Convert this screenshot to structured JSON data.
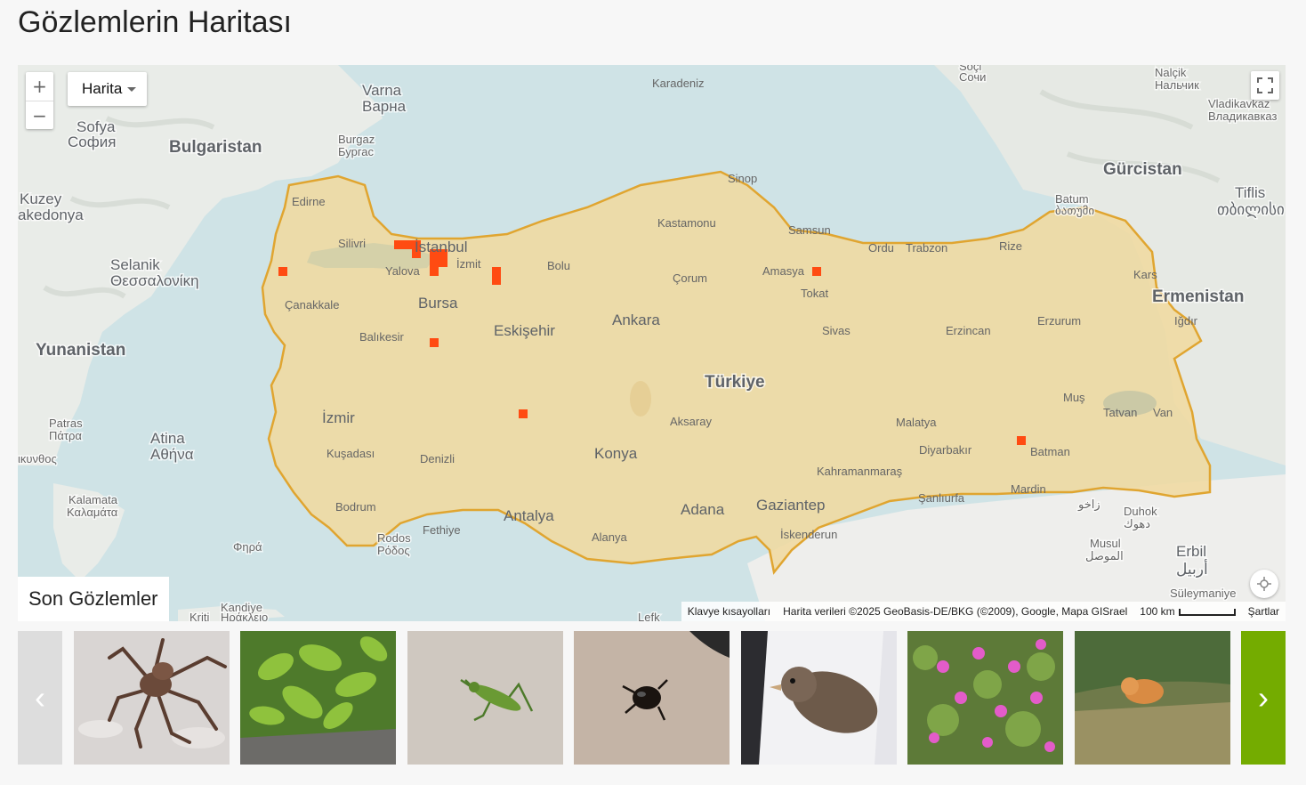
{
  "page": {
    "title": "Gözlemlerin Haritası"
  },
  "map": {
    "controls": {
      "zoom_in": "+",
      "zoom_out": "−",
      "map_type": "Harita"
    },
    "overlay_label": "Son Gözlemler",
    "attribution": {
      "shortcuts": "Klavye kısayolları",
      "data": "Harita verileri ©2025 GeoBasis-DE/BKG (©2009), Google, Mapa GISrael",
      "scale": "100 km",
      "terms": "Şartlar"
    },
    "labels": {
      "sea": "Karadeniz",
      "bulgaria": "Bulgaristan",
      "georgia": "Gürcistan",
      "armenia": "Ermenistan",
      "greece": "Yunanistan",
      "turkey": "Türkiye",
      "north_macedonia_1": "Kuzey",
      "north_macedonia_2": "akedonya",
      "varna_1": "Varna",
      "varna_2": "Варна",
      "sofia_1": "Sofya",
      "sofia_2": "София",
      "burgaz_1": "Burgaz",
      "burgaz_2": "Бургас",
      "selanik_1": "Selanik",
      "selanik_2": "Θεσσαλονίκη",
      "athens_1": "Atina",
      "athens_2": "Αθήνα",
      "patras_1": "Patras",
      "patras_2": "Πάτρα",
      "kalamata_1": "Kalamata",
      "kalamata_2": "Καλαμάτα",
      "rodos_1": "Rodos",
      "rodos_2": "Ρόδος",
      "kandiye_1": "Kandiye",
      "kandiye_2": "Ηράκλειο",
      "fira": "Φηρά",
      "sochi_1": "Soçi",
      "sochi_2": "Сочи",
      "nalcik_1": "Nalçik",
      "nalcik_2": "Нальчик",
      "vladikavkaz_1": "Vladikavkaz",
      "vladikavkaz_2": "Владикавказ",
      "tiflis_1": "Tiflis",
      "tiflis_2": "თბილისი",
      "batum_1": "Batum",
      "batum_2": "ბათუმი",
      "erbil_1": "Erbil",
      "erbil_2": "أربيل",
      "musul_1": "Musul",
      "musul_2": "الموصل",
      "duhok_1": "Duhok",
      "duhok_2": "دهوك",
      "zakho": "زاخو",
      "suleymaniye": "Süleymaniye",
      "edirne": "Edirne",
      "silivri": "Silivri",
      "istanbul": "İstanbul",
      "yalova": "Yalova",
      "izmit": "İzmit",
      "bursa": "Bursa",
      "bolu": "Bolu",
      "canakkale": "Çanakkale",
      "balikesir": "Balıkesir",
      "eskisehir": "Eskişehir",
      "ankara": "Ankara",
      "kastamonu": "Kastamonu",
      "sinop": "Sinop",
      "samsun": "Samsun",
      "ordu": "Ordu",
      "trabzon": "Trabzon",
      "rize": "Rize",
      "amasya": "Amasya",
      "corum": "Çorum",
      "tokat": "Tokat",
      "kars": "Kars",
      "igdir": "Iğdır",
      "erzurum": "Erzurum",
      "erzincan": "Erzincan",
      "sivas": "Sivas",
      "izmir": "İzmir",
      "kusadasi": "Kuşadası",
      "denizli": "Denizli",
      "bodrum": "Bodrum",
      "fethiye": "Fethiye",
      "antalya": "Antalya",
      "alanya": "Alanya",
      "konya": "Konya",
      "aksaray": "Aksaray",
      "adana": "Adana",
      "gaziantep": "Gaziantep",
      "iskenderun": "İskenderun",
      "kahramanmaras": "Kahramanmaraş",
      "malatya": "Malatya",
      "diyarbakir": "Diyarbakır",
      "sanliurfa": "Şanlıurfa",
      "mardin": "Mardin",
      "batman": "Batman",
      "mus": "Muş",
      "tatvan": "Tatvan",
      "van": "Van",
      "kritiki": "Kriti",
      "lefko": "Lefk",
      "ikunthos": "ικυνθος"
    }
  },
  "colors": {
    "accent": "#74ac00",
    "marker": "#ff4b12",
    "turkey_fill": "#f0d9a0",
    "border": "#e0a530"
  },
  "carousel": {
    "prev": "‹",
    "next": "›",
    "items": [
      {
        "icon": "spider-photo"
      },
      {
        "icon": "plant-photo"
      },
      {
        "icon": "grasshopper-photo"
      },
      {
        "icon": "beetle-photo"
      },
      {
        "icon": "bird-photo"
      },
      {
        "icon": "flower-photo"
      },
      {
        "icon": "cat-photo"
      }
    ]
  }
}
